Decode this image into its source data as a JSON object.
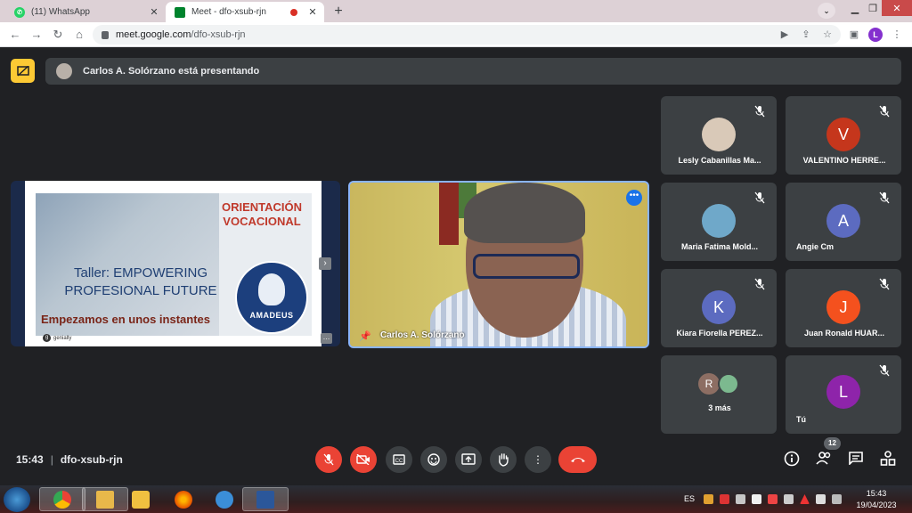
{
  "browser": {
    "tabs": [
      {
        "title": "(11) WhatsApp",
        "favicon": "whatsapp-icon",
        "active": false
      },
      {
        "title": "Meet - dfo-xsub-rjn",
        "favicon": "meet-icon",
        "active": true,
        "recording": true
      }
    ],
    "url_host": "meet.google.com",
    "url_path": "/dfo-xsub-rjn",
    "profile_initial": "L"
  },
  "meet": {
    "presenting_text": "Carlos A. Solórzano está presentando",
    "slide": {
      "title_line1": "ORIENTACIÓN",
      "title_line2": "VOCACIONAL",
      "workshop_line1": "Taller: EMPOWERING",
      "workshop_line2": "PROFESIONAL FUTURE",
      "starting": "Empezamos en unos instantes",
      "logo_text": "AMADEUS",
      "brand": "genially"
    },
    "camera_name": "Carlos A. Solórzano",
    "participants": [
      {
        "name": "Lesly Cabanillas Ma...",
        "initial": "",
        "color": "#d9c9b8",
        "muted": true
      },
      {
        "name": "VALENTINO HERRE...",
        "initial": "V",
        "color": "#c5361c",
        "muted": true
      },
      {
        "name": "Maria Fatima Mold...",
        "initial": "",
        "color": "#6fa8c9",
        "muted": true
      },
      {
        "name": "Angie Cm",
        "initial": "A",
        "color": "#5c6bc0",
        "muted": true
      },
      {
        "name": "Kiara Fiorella PEREZ...",
        "initial": "K",
        "color": "#5c6bc0",
        "muted": true
      },
      {
        "name": "Juan Ronald HUAR...",
        "initial": "J",
        "color": "#f4511e",
        "muted": true
      },
      {
        "name": "3 más",
        "initial": "R",
        "color": "#8d6e63",
        "muted": false
      },
      {
        "name": "Tú",
        "initial": "L",
        "color": "#8e24aa",
        "muted": true
      }
    ],
    "time": "15:43",
    "meeting_code": "dfo-xsub-rjn",
    "participant_count": "12",
    "colors": {
      "accent": "#8ab4f8",
      "danger": "#ea4335",
      "presenter_icon": "#fcc934"
    }
  },
  "taskbar": {
    "language": "ES",
    "time": "15:43",
    "date": "19/04/2023"
  }
}
